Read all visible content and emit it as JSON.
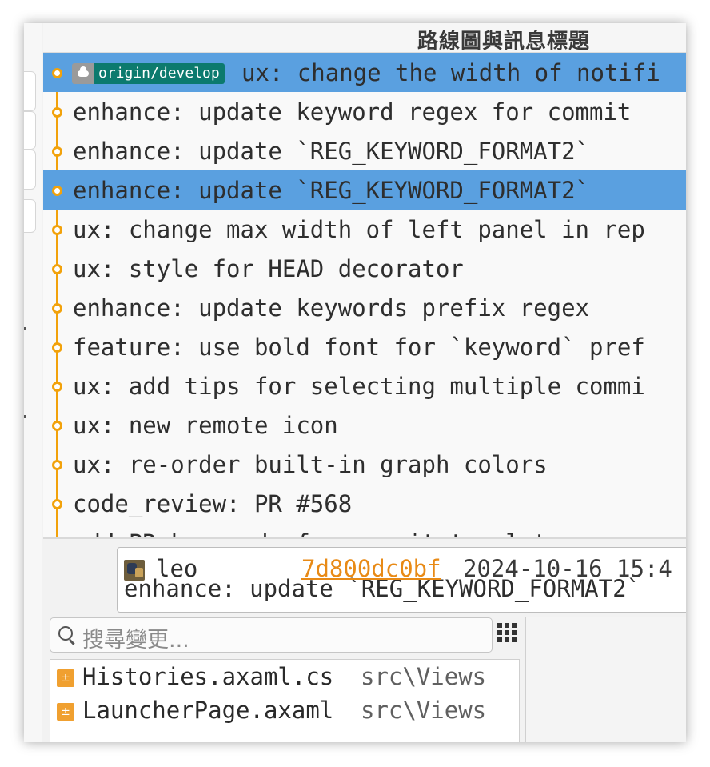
{
  "header": {
    "title": "路線圖與訊息標題"
  },
  "commits": [
    {
      "message": "ux: change the width of notifi",
      "selected": true,
      "branch_badge": "origin/develop"
    },
    {
      "message": "enhance: update keyword regex for commit",
      "selected": false
    },
    {
      "message": "enhance: update `REG_KEYWORD_FORMAT2`",
      "selected": false
    },
    {
      "message": "enhance: update `REG_KEYWORD_FORMAT2`",
      "selected": true
    },
    {
      "message": "ux: change max width of left panel in rep",
      "selected": false
    },
    {
      "message": "ux: style for HEAD decorator",
      "selected": false
    },
    {
      "message": "enhance: update keywords prefix regex",
      "selected": false
    },
    {
      "message": "feature: use bold font for `keyword` pref",
      "selected": false
    },
    {
      "message": "ux: add tips for selecting multiple commi",
      "selected": false
    },
    {
      "message": "ux: new remote icon",
      "selected": false
    },
    {
      "message": "ux: re-order built-in graph colors",
      "selected": false
    },
    {
      "message": "code_review: PR #568",
      "selected": false
    },
    {
      "message": "add PR keywords for commit templates",
      "selected": false
    }
  ],
  "commit_tooltip": {
    "author": "leo",
    "sha": "7d800dc0bf",
    "date": "2024-10-16 15:4",
    "subject": "enhance: update `REG_KEYWORD_FORMAT2`"
  },
  "changes": {
    "search_placeholder": "搜尋變更...",
    "files": [
      {
        "name": "Histories.axaml.cs",
        "path": "src\\Views",
        "status": "±"
      },
      {
        "name": "LauncherPage.axaml",
        "path": "src\\Views",
        "status": "±"
      }
    ]
  },
  "colors": {
    "graph": "#f2a20b",
    "selection": "#5aa0e0",
    "badge": "#0c7a6e",
    "sha": "#e88a16",
    "file_status": "#f0a030"
  },
  "icons": {
    "remote": "cloud-icon",
    "search": "search-icon",
    "grid": "grid-view-icon",
    "avatar": "author-avatar"
  }
}
